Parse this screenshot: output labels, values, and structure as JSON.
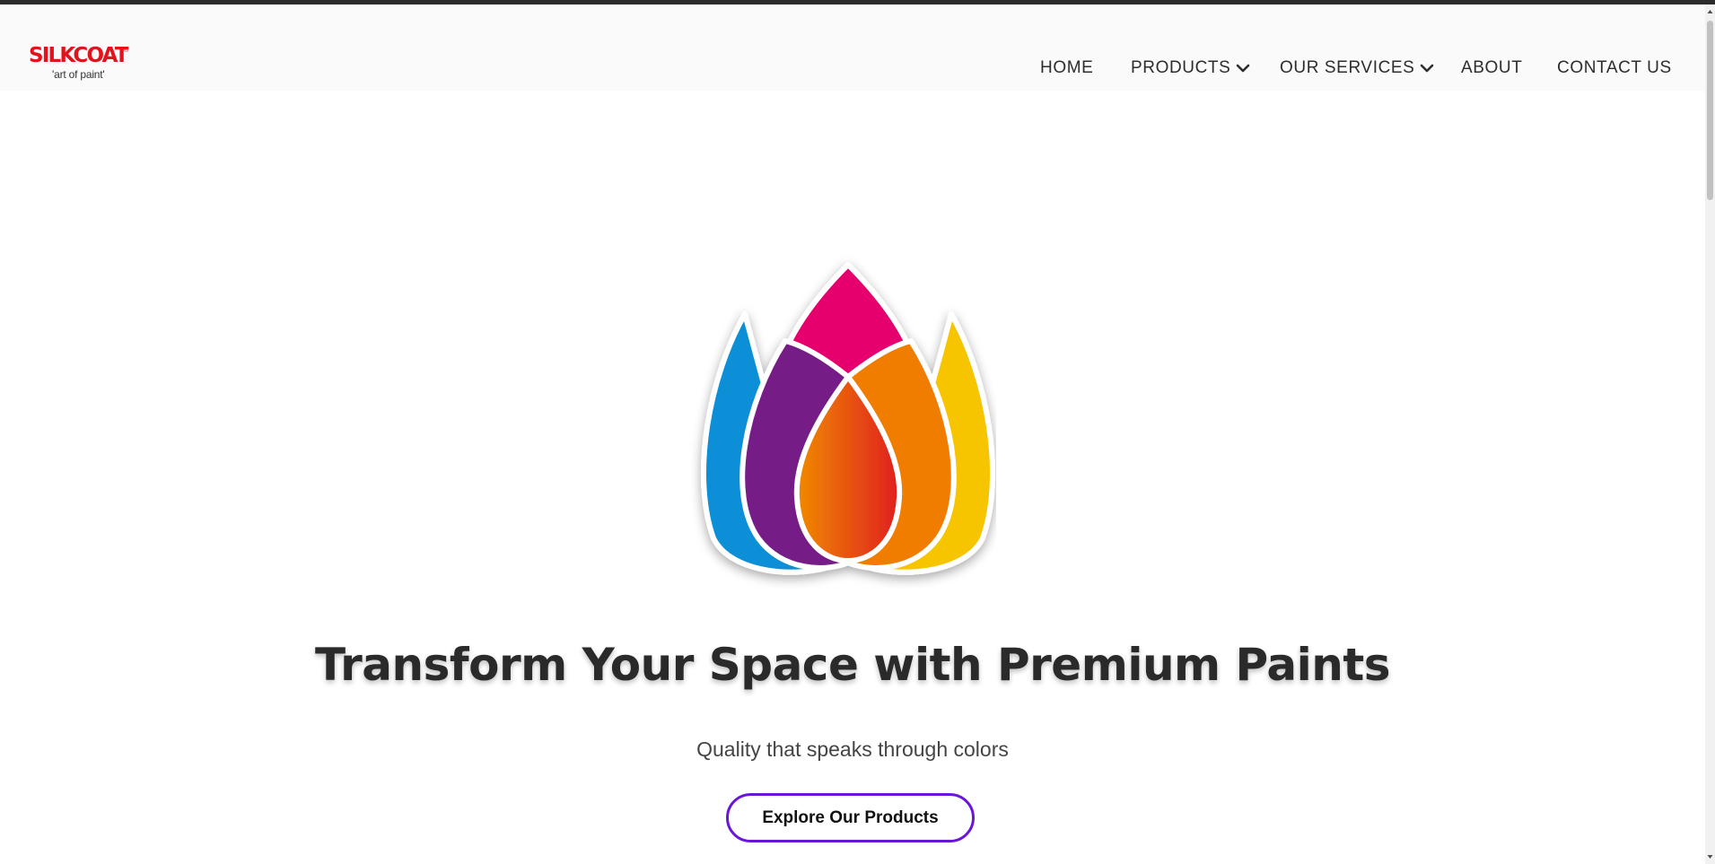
{
  "brand": {
    "name": "SILKCOAT",
    "registered": "®",
    "tagline": "'art of paint'"
  },
  "nav": {
    "items": [
      {
        "label": "HOME",
        "dropdown": false
      },
      {
        "label": "PRODUCTS",
        "dropdown": true
      },
      {
        "label": "OUR SERVICES",
        "dropdown": true
      },
      {
        "label": "ABOUT",
        "dropdown": false
      },
      {
        "label": "CONTACT US",
        "dropdown": false
      }
    ]
  },
  "hero": {
    "logo_icon": "paint-petal-logo-icon",
    "headline": "Transform Your Space with Premium Paints",
    "subheadline": "Quality that speaks through colors",
    "cta_label": "Explore Our Products"
  },
  "colors": {
    "brand_red": "#e1131c",
    "cta_border": "#6a16d8",
    "petal_blue": "#0a8fd8",
    "petal_magenta": "#e5006e",
    "petal_yellow": "#f7c500",
    "petal_purple": "#741c86",
    "petal_orange": "#f07c00",
    "petal_red": "#e3231f"
  }
}
